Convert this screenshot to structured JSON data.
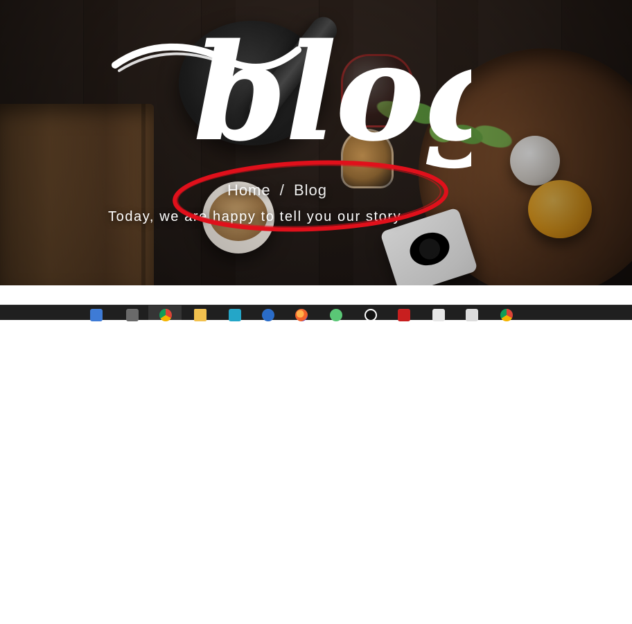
{
  "hero": {
    "title_script": "blog",
    "breadcrumb": {
      "home": "Home",
      "separator": "/",
      "current": "Blog"
    },
    "tagline": "Today, we are happy to tell you our story"
  },
  "annotation": {
    "color": "#e0101b"
  },
  "taskbar": {
    "icons": [
      {
        "name": "task-view-icon"
      },
      {
        "name": "sublime-text-icon"
      },
      {
        "name": "chrome-icon",
        "active": true
      },
      {
        "name": "file-explorer-icon"
      },
      {
        "name": "app-icon"
      },
      {
        "name": "app-icon-2"
      },
      {
        "name": "firefox-icon"
      },
      {
        "name": "app-icon-3"
      },
      {
        "name": "app-icon-4"
      },
      {
        "name": "filezilla-icon"
      },
      {
        "name": "calculator-icon"
      },
      {
        "name": "photos-icon"
      },
      {
        "name": "chrome-icon-2"
      }
    ],
    "tray": {
      "up_arrow": "^"
    }
  }
}
